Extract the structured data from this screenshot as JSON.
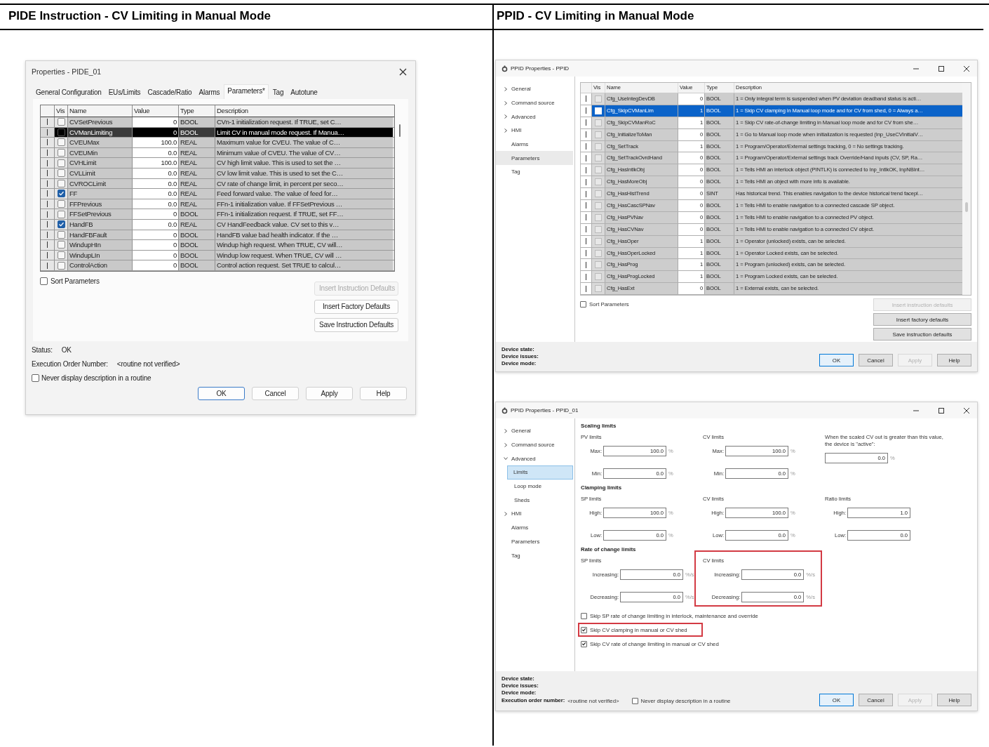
{
  "headings": [
    {
      "text": "PIDE Instruction - CV Limiting in Manual Mode"
    },
    {
      "text": "PPID - CV Limiting in Manual Mode"
    }
  ],
  "pide_dialog": {
    "title": "Properties - PIDE_01",
    "tabs": [
      {
        "label": "General Configuration",
        "selected": false
      },
      {
        "label": "EUs/Limits",
        "selected": false
      },
      {
        "label": "Cascade/Ratio",
        "selected": false
      },
      {
        "label": "Alarms",
        "selected": false
      },
      {
        "label": "Parameters*",
        "selected": true
      },
      {
        "label": "Tag",
        "selected": false
      },
      {
        "label": "Autotune",
        "selected": false
      }
    ],
    "columns": [
      "Vis",
      "Name",
      "Value",
      "Type",
      "Description"
    ],
    "rows": [
      {
        "name": "CVSetPrevious",
        "value": "0",
        "type": "BOOL",
        "description": "CVn-1 initialization request.  If TRUE, set C…",
        "vis": false,
        "selected": false
      },
      {
        "name": "CVManLimiting",
        "value": "0",
        "type": "BOOL",
        "description": "Limit CV in manual mode request.  If Manua…",
        "vis": false,
        "selected": true
      },
      {
        "name": "CVEUMax",
        "value": "100.0",
        "type": "REAL",
        "description": "Maximum value for CVEU.  The value of C…",
        "vis": false,
        "selected": false
      },
      {
        "name": "CVEUMin",
        "value": "0.0",
        "type": "REAL",
        "description": "Minimum value of CVEU.  The value of CV…",
        "vis": false,
        "selected": false
      },
      {
        "name": "CVHLimit",
        "value": "100.0",
        "type": "REAL",
        "description": "CV high limit value.  This is used to set the …",
        "vis": false,
        "selected": false
      },
      {
        "name": "CVLLimit",
        "value": "0.0",
        "type": "REAL",
        "description": "CV low limit value.  This is used to set the C…",
        "vis": false,
        "selected": false
      },
      {
        "name": "CVROCLimit",
        "value": "0.0",
        "type": "REAL",
        "description": "CV rate of change limit, in percent per seco…",
        "vis": false,
        "selected": false
      },
      {
        "name": "FF",
        "value": "0.0",
        "type": "REAL",
        "description": "Feed forward value.  The value of feed for…",
        "vis": true,
        "selected": false
      },
      {
        "name": "FFPrevious",
        "value": "0.0",
        "type": "REAL",
        "description": "FFn-1 initialization value.  If FFSetPrevious …",
        "vis": false,
        "selected": false
      },
      {
        "name": "FFSetPrevious",
        "value": "0",
        "type": "BOOL",
        "description": "FFn-1 initialization request.  If TRUE, set FF…",
        "vis": false,
        "selected": false
      },
      {
        "name": "HandFB",
        "value": "0.0",
        "type": "REAL",
        "description": "CV HandFeedback value.  CV set to this v…",
        "vis": true,
        "selected": false
      },
      {
        "name": "HandFBFault",
        "value": "0",
        "type": "BOOL",
        "description": "HandFB value bad health indicator.  If the …",
        "vis": false,
        "selected": false
      },
      {
        "name": "WindupHIn",
        "value": "0",
        "type": "BOOL",
        "description": "Windup high request.  When TRUE, CV will…",
        "vis": false,
        "selected": false
      },
      {
        "name": "WindupLIn",
        "value": "0",
        "type": "BOOL",
        "description": "Windup low request.  When TRUE, CV will …",
        "vis": false,
        "selected": false
      },
      {
        "name": "ControlAction",
        "value": "0",
        "type": "BOOL",
        "description": "Control action request.  Set TRUE to calcul…",
        "vis": false,
        "selected": false
      }
    ],
    "sort_parameters": {
      "label": "Sort Parameters",
      "checked": false
    },
    "side_buttons": [
      {
        "label": "Insert Instruction Defaults",
        "disabled": true
      },
      {
        "label": "Insert Factory Defaults",
        "disabled": false
      },
      {
        "label": "Save Instruction Defaults",
        "disabled": false
      }
    ],
    "status": {
      "label": "Status:",
      "value": "OK"
    },
    "execution_order": {
      "label": "Execution Order Number:",
      "value": "<routine not verified>"
    },
    "never_display": {
      "label": "Never display description in a routine",
      "checked": false
    },
    "buttons": [
      {
        "label": "OK",
        "default": true,
        "disabled": false
      },
      {
        "label": "Cancel",
        "default": false,
        "disabled": false
      },
      {
        "label": "Apply",
        "default": false,
        "disabled": false
      },
      {
        "label": "Help",
        "default": false,
        "disabled": false
      }
    ]
  },
  "ppid_parameters": {
    "title": "PPID Properties - PPID",
    "nav": [
      {
        "label": "General",
        "expanded": false,
        "selected": false
      },
      {
        "label": "Command source",
        "expanded": false,
        "selected": false
      },
      {
        "label": "Advanced",
        "expanded": false,
        "selected": false
      },
      {
        "label": "HMI",
        "expanded": false,
        "selected": false
      },
      {
        "label": "Alarms",
        "selected": false
      },
      {
        "label": "Parameters",
        "selected": true
      },
      {
        "label": "Tag",
        "selected": false
      }
    ],
    "columns": [
      "Vis",
      "Name",
      "Value",
      "Type",
      "Description"
    ],
    "rows": [
      {
        "name": "Cfg_UseIntegDevDB",
        "value": "0",
        "type": "BOOL",
        "description": "1 = Only integral term is suspended when PV deviation deadband status is acti…",
        "vis": false,
        "selected": false
      },
      {
        "name": "Cfg_SkipCVManLim",
        "value": "1",
        "type": "BOOL",
        "description": "1 = Skip CV clamping in Manual loop mode and for CV from shed, 0 = Always a…",
        "vis": false,
        "selected": true
      },
      {
        "name": "Cfg_SkipCVManRoC",
        "value": "1",
        "type": "BOOL",
        "description": "1 = Skip CV rate-of-change limiting in Manual loop mode and for CV from she…",
        "vis": false,
        "selected": false
      },
      {
        "name": "Cfg_InitializeToMan",
        "value": "0",
        "type": "BOOL",
        "description": "1 = Go to Manual loop mode when initialization is requested (Inp_UseCVInitialV…",
        "vis": false,
        "selected": false
      },
      {
        "name": "Cfg_SetTrack",
        "value": "1",
        "type": "BOOL",
        "description": "1 = Program/Operator/External settings tracking, 0 = No settings tracking.",
        "vis": false,
        "selected": false
      },
      {
        "name": "Cfg_SetTrackOvrdHand",
        "value": "0",
        "type": "BOOL",
        "description": "1 = Program/Operator/External settings track Override/Hand inputs (CV, SP, Ra…",
        "vis": false,
        "selected": false
      },
      {
        "name": "Cfg_HasIntlkObj",
        "value": "0",
        "type": "BOOL",
        "description": "1 = Tells HMI an interlock object (PINTLK) is connected to Inp_IntlkOK, InpNBInt…",
        "vis": false,
        "selected": false
      },
      {
        "name": "Cfg_HasMoreObj",
        "value": "0",
        "type": "BOOL",
        "description": "1 = Tells HMI an object with more info is available.",
        "vis": false,
        "selected": false
      },
      {
        "name": "Cfg_HasHistTrend",
        "value": "0",
        "type": "SINT",
        "description": "Has historical trend. This enables navigation to the device historical trend facepl…",
        "vis": false,
        "selected": false
      },
      {
        "name": "Cfg_HasCascSPNav",
        "value": "0",
        "type": "BOOL",
        "description": "1 = Tells HMI to enable navigation to a connected cascade SP object.",
        "vis": false,
        "selected": false
      },
      {
        "name": "Cfg_HasPVNav",
        "value": "0",
        "type": "BOOL",
        "description": "1 = Tells HMI to enable navigation to a connected PV object.",
        "vis": false,
        "selected": false
      },
      {
        "name": "Cfg_HasCVNav",
        "value": "0",
        "type": "BOOL",
        "description": "1 = Tells HMI to enable navigation to a connected CV object.",
        "vis": false,
        "selected": false
      },
      {
        "name": "Cfg_HasOper",
        "value": "1",
        "type": "BOOL",
        "description": "1 = Operator (unlocked) exists, can be selected.",
        "vis": false,
        "selected": false
      },
      {
        "name": "Cfg_HasOperLocked",
        "value": "1",
        "type": "BOOL",
        "description": "1 = Operator Locked exists, can be selected.",
        "vis": false,
        "selected": false
      },
      {
        "name": "Cfg_HasProg",
        "value": "1",
        "type": "BOOL",
        "description": "1 = Program (unlocked) exists, can be selected.",
        "vis": false,
        "selected": false
      },
      {
        "name": "Cfg_HasProgLocked",
        "value": "1",
        "type": "BOOL",
        "description": "1 = Program Locked exists, can be selected.",
        "vis": false,
        "selected": false
      },
      {
        "name": "Cfg_HasExt",
        "value": "0",
        "type": "BOOL",
        "description": "1 = External exists, can be selected.",
        "vis": false,
        "selected": false
      }
    ],
    "sort_parameters": {
      "label": "Sort Parameters",
      "checked": false
    },
    "side_buttons": [
      {
        "label": "Insert instruction defaults",
        "disabled": true
      },
      {
        "label": "Insert factory defaults",
        "disabled": false
      },
      {
        "label": "Save instruction defaults",
        "disabled": false
      }
    ],
    "device_labels": [
      "Device state:",
      "Device issues:",
      "Device mode:"
    ],
    "buttons": [
      {
        "label": "OK",
        "default": true,
        "disabled": false
      },
      {
        "label": "Cancel",
        "default": false,
        "disabled": false
      },
      {
        "label": "Apply",
        "default": false,
        "disabled": true
      },
      {
        "label": "Help",
        "default": false,
        "disabled": false
      }
    ]
  },
  "ppid_limits": {
    "title": "PPID Properties - PPID_01",
    "nav": [
      {
        "label": "General",
        "expanded": false,
        "selected": false
      },
      {
        "label": "Command source",
        "expanded": false,
        "selected": false
      },
      {
        "label": "Advanced",
        "expanded": true,
        "selected": false,
        "children": [
          {
            "label": "Limits",
            "selected": true
          },
          {
            "label": "Loop mode",
            "selected": false
          },
          {
            "label": "Sheds",
            "selected": false
          }
        ]
      },
      {
        "label": "HMI",
        "expanded": false,
        "selected": false
      },
      {
        "label": "Alarms",
        "selected": false
      },
      {
        "label": "Parameters",
        "selected": false
      },
      {
        "label": "Tag",
        "selected": false
      }
    ],
    "sections": [
      {
        "title": "Scaling limits",
        "groups": [
          {
            "label": "PV limits",
            "highlighted": false,
            "fields": [
              {
                "label": "Max:",
                "value": "100.0",
                "unit": "%"
              },
              {
                "label": "Min:",
                "value": "0.0",
                "unit": "%"
              }
            ]
          },
          {
            "label": "CV limits",
            "highlighted": false,
            "fields": [
              {
                "label": "Max:",
                "value": "100.0",
                "unit": "%"
              },
              {
                "label": "Min:",
                "value": "0.0",
                "unit": "%"
              }
            ]
          },
          {
            "label": "When the scaled CV out is greater than this value, the device is \"active\":",
            "highlighted": false,
            "fields": [
              {
                "value": "0.0",
                "unit": "%"
              }
            ]
          }
        ]
      },
      {
        "title": "Clamping limits",
        "groups": [
          {
            "label": "SP limits",
            "highlighted": false,
            "fields": [
              {
                "label": "High:",
                "value": "100.0",
                "unit": "%"
              },
              {
                "label": "Low:",
                "value": "0.0",
                "unit": "%"
              }
            ]
          },
          {
            "label": "CV limits",
            "highlighted": false,
            "fields": [
              {
                "label": "High:",
                "value": "100.0",
                "unit": "%"
              },
              {
                "label": "Low:",
                "value": "0.0",
                "unit": "%"
              }
            ]
          },
          {
            "label": "Ratio limits",
            "highlighted": false,
            "fields": [
              {
                "label": "High:",
                "value": "1.0"
              },
              {
                "label": "Low:",
                "value": "0.0"
              }
            ]
          }
        ]
      },
      {
        "title": "Rate of change limits",
        "groups": [
          {
            "label": "SP limits",
            "highlighted": false,
            "fields": [
              {
                "label": "Increasing:",
                "value": "0.0",
                "unit": "%/s"
              },
              {
                "label": "Decreasing:",
                "value": "0.0",
                "unit": "%/s"
              }
            ]
          },
          {
            "label": "CV limits",
            "highlighted": true,
            "fields": [
              {
                "label": "Increasing:",
                "value": "0.0",
                "unit": "%/s"
              },
              {
                "label": "Decreasing:",
                "value": "0.0",
                "unit": "%/s"
              }
            ]
          }
        ]
      }
    ],
    "options": [
      {
        "label": "Skip SP rate of change limiting in interlock, maintenance and override",
        "checked": false,
        "highlighted": false
      },
      {
        "label": "Skip CV clamping in manual or CV shed",
        "checked": true,
        "highlighted": true
      },
      {
        "label": "Skip CV rate of change limiting in manual or CV shed",
        "checked": true,
        "highlighted": false
      }
    ],
    "device_labels": [
      "Device state:",
      "Device issues:",
      "Device mode:"
    ],
    "execution_order": {
      "label": "Execution order number:",
      "value": "<routine not verified>"
    },
    "never_display": {
      "label": "Never display description in a routine",
      "checked": false
    },
    "buttons": [
      {
        "label": "OK",
        "default": true,
        "disabled": false
      },
      {
        "label": "Cancel",
        "default": false,
        "disabled": false
      },
      {
        "label": "Apply",
        "default": false,
        "disabled": true
      },
      {
        "label": "Help",
        "default": false,
        "disabled": false
      }
    ]
  }
}
